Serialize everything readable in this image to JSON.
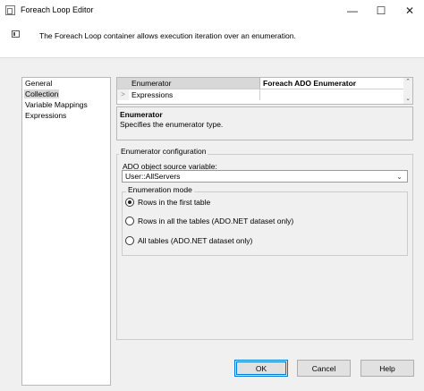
{
  "window": {
    "title": "Foreach Loop Editor",
    "minimize_glyph": "—",
    "maximize_glyph": "☐",
    "close_glyph": "✕"
  },
  "header": {
    "description": "The Foreach Loop container allows execution iteration over an enumeration."
  },
  "nav": {
    "items": [
      {
        "label": "General",
        "selected": false
      },
      {
        "label": "Collection",
        "selected": true
      },
      {
        "label": "Variable Mappings",
        "selected": false
      },
      {
        "label": "Expressions",
        "selected": false
      }
    ]
  },
  "property_grid": {
    "rows": [
      {
        "name": "Enumerator",
        "value": "Foreach ADO Enumerator"
      },
      {
        "name": "Expressions",
        "value": "",
        "expand_glyph": ">"
      }
    ],
    "scroll_up_glyph": "⌃",
    "scroll_down_glyph": "⌄"
  },
  "description_panel": {
    "title": "Enumerator",
    "text": "Specifies the enumerator type."
  },
  "enumerator_configuration": {
    "group_title": "Enumerator configuration",
    "ado_source_label": "ADO object source variable:",
    "ado_source_value": "User::AllServers",
    "chevron_glyph": "⌄",
    "enumeration_mode": {
      "group_title": "Enumeration mode",
      "options": [
        {
          "label": "Rows in the first table",
          "checked": true
        },
        {
          "label": "Rows in all the tables (ADO.NET dataset only)",
          "checked": false
        },
        {
          "label": "All tables (ADO.NET dataset only)",
          "checked": false
        }
      ]
    }
  },
  "buttons": {
    "ok": "OK",
    "cancel": "Cancel",
    "help": "Help"
  },
  "colors": {
    "selection_highlight": "#d8d8d8",
    "default_button_border": "#0078d7"
  }
}
